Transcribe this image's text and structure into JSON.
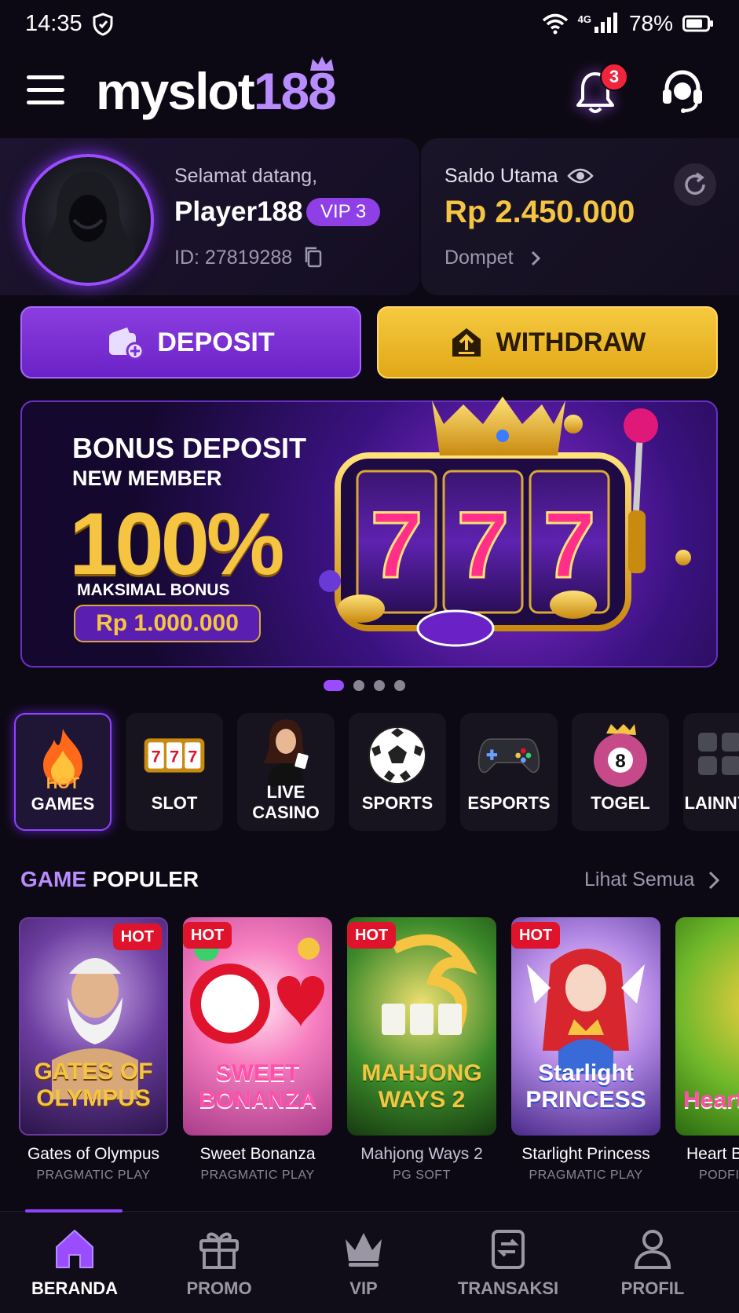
{
  "status_bar": {
    "time": "14:35",
    "network": "4G",
    "battery": "78%"
  },
  "header": {
    "logo_text_a": "myslot",
    "logo_text_b": "188",
    "notification_count": "3"
  },
  "profile": {
    "welcome": "Selamat datang,",
    "username": "Player188",
    "vip": "VIP 3",
    "id": "ID: 27819288"
  },
  "balance": {
    "label": "Saldo Utama",
    "value": "Rp 2.450.000",
    "wallet_link": "Dompet"
  },
  "actions": {
    "deposit": "DEPOSIT",
    "withdraw": "WITHDRAW"
  },
  "banner": {
    "title": "BONUS DEPOSIT",
    "subtitle": "NEW MEMBER",
    "percent": "100%",
    "max_label": "MAKSIMAL BONUS",
    "max_amount": "Rp 1.000.000",
    "slot_digits": [
      "7",
      "7",
      "7"
    ],
    "slides": 4,
    "active_slide": 1
  },
  "categories": [
    {
      "badge": "HOT",
      "label": "GAMES",
      "icon": "flame-icon",
      "active": true
    },
    {
      "label": "SLOT",
      "icon": "slot-reels-icon",
      "reel_text": "777"
    },
    {
      "label": "LIVE CASINO",
      "icon": "dealer-icon"
    },
    {
      "label": "SPORTS",
      "icon": "soccer-ball-icon"
    },
    {
      "label": "ESPORTS",
      "icon": "gamepad-icon"
    },
    {
      "label": "TOGEL",
      "icon": "eight-ball-icon",
      "ball_number": "8"
    },
    {
      "label": "LAINNYA",
      "icon": "grid-icon"
    }
  ],
  "popular": {
    "title_a": "GAME",
    "title_b": "POPULER",
    "see_all": "Lihat Semua",
    "games": [
      {
        "name": "Gates of Olympus",
        "provider": "PRAGMATIC PLAY",
        "badge": "HOT",
        "art_text": "GATES OF OLYMPUS"
      },
      {
        "name": "Sweet Bonanza",
        "provider": "PRAGMATIC PLAY",
        "badge": "HOT",
        "art_text": "SWEET BONANZA"
      },
      {
        "name": "Mahjong Ways 2",
        "provider": "PG SOFT",
        "badge": "HOT",
        "art_text": "MAHJONG WAYS 2"
      },
      {
        "name": "Starlight Princess",
        "provider": "PRAGMATIC PLAY",
        "badge": "HOT",
        "art_text": "Starlight PRINCESS"
      },
      {
        "name": "Heart Bonanza",
        "provider": "PODFI",
        "art_text": "Heart Bon"
      }
    ]
  },
  "nav": [
    {
      "label": "BERANDA",
      "icon": "home-icon",
      "active": true
    },
    {
      "label": "PROMO",
      "icon": "gift-icon"
    },
    {
      "label": "VIP",
      "icon": "crown-icon"
    },
    {
      "label": "TRANSAKSI",
      "icon": "transaction-icon"
    },
    {
      "label": "PROFIL",
      "icon": "user-icon"
    }
  ],
  "colors": {
    "background": "#0d0914",
    "accent_purple": "#8e3fe6",
    "gold": "#f5c542",
    "hot_red": "#e0132c"
  }
}
